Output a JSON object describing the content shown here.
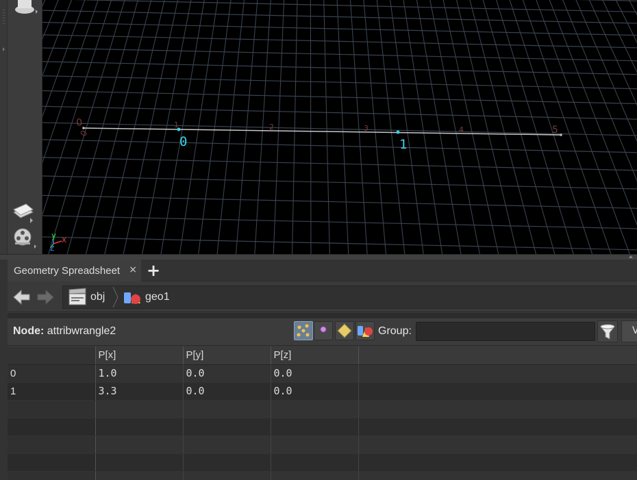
{
  "viewport": {
    "grid_ruler_labels": [
      "0",
      "0",
      "1",
      "2",
      "3",
      "4",
      "5"
    ],
    "point_numbers": [
      "0",
      "1"
    ],
    "axis_labels": {
      "x": "x",
      "y": "y",
      "z": "z"
    },
    "grid_color": "#3a4350",
    "line_color": "#c8c8c8",
    "point_color": "#35d7e8",
    "ruler_color": "#7a3a3a"
  },
  "panel": {
    "tab_title": "Geometry Spreadsheet",
    "tab_close": "×",
    "tab_add": "+"
  },
  "pathbar": {
    "segments": [
      {
        "label": "obj",
        "icon": "clapperboard-icon"
      },
      {
        "label": "geo1",
        "icon": "geometry-icon"
      }
    ]
  },
  "toolbar": {
    "node_prefix": "Node:",
    "node_name": "attribwrangle2",
    "group_label": "Group:",
    "group_value": "",
    "view_label": "V"
  },
  "spreadsheet": {
    "columns": [
      "",
      "P[x]",
      "P[y]",
      "P[z]"
    ],
    "rows": [
      [
        "0",
        "1.0",
        "0.0",
        "0.0"
      ],
      [
        "1",
        "3.3",
        "0.0",
        "0.0"
      ]
    ],
    "empty_rows": 5
  }
}
